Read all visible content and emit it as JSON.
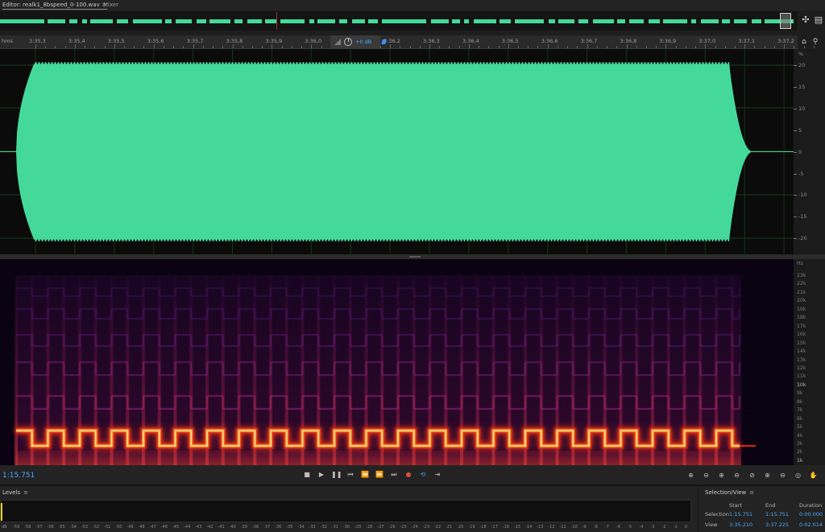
{
  "tabs": {
    "editor_label": "Editor: realk1_8bspeed_0-100.wav",
    "editor_menu": "≡",
    "mixer_label": "Mixer"
  },
  "ruler": {
    "unit": "hms",
    "ticks": [
      "3:35,3",
      "3:35,4",
      "3:35,5",
      "3:35,6",
      "3:35,7",
      "3:35,8",
      "3:35,9",
      "3:36,0",
      "3:36,1",
      "3:36,2",
      "3:36,3",
      "3:36,4",
      "3:36,5",
      "3:36,6",
      "3:36,7",
      "3:36,8",
      "3:36,9",
      "3:37,0",
      "3:37,1",
      "3:37,2"
    ]
  },
  "hud": {
    "gain_db": "+0 dB"
  },
  "amplitude_scale": {
    "unit": "%",
    "labels": [
      "20",
      "15",
      "10",
      "5",
      "0",
      "-5",
      "-10",
      "-15",
      "-20"
    ]
  },
  "frequency_scale": {
    "unit": "Hz",
    "labels": [
      "23k",
      "22k",
      "21k",
      "20k",
      "19k",
      "18k",
      "17k",
      "16k",
      "15k",
      "14k",
      "13k",
      "12k",
      "11k",
      "10k",
      "9k",
      "8k",
      "7k",
      "6k",
      "5k",
      "4k",
      "3k",
      "2k",
      "1k"
    ]
  },
  "transport": {
    "current_time": "1:15.751"
  },
  "levels": {
    "title": "Levels",
    "menu": "≡",
    "scale": [
      "dB",
      "-59",
      "-58",
      "-57",
      "-56",
      "-55",
      "-54",
      "-53",
      "-52",
      "-51",
      "-50",
      "-49",
      "-48",
      "-47",
      "-46",
      "-45",
      "-44",
      "-43",
      "-42",
      "-41",
      "-40",
      "-39",
      "-38",
      "-37",
      "-36",
      "-35",
      "-34",
      "-33",
      "-32",
      "-31",
      "-30",
      "-29",
      "-28",
      "-27",
      "-26",
      "-25",
      "-24",
      "-23",
      "-22",
      "-21",
      "-20",
      "-19",
      "-18",
      "-17",
      "-16",
      "-15",
      "-14",
      "-13",
      "-12",
      "-11",
      "-10",
      "-9",
      "-8",
      "-7",
      "-6",
      "-5",
      "-4",
      "-3",
      "-2",
      "-1",
      "0"
    ]
  },
  "selection_view": {
    "title": "Selection/View",
    "menu": "≡",
    "headers": {
      "start": "Start",
      "end": "End",
      "duration": "Duration"
    },
    "selection": {
      "label": "Selection",
      "start": "1:15.751",
      "end": "1:15.751",
      "duration": "0:00.000"
    },
    "view": {
      "label": "View",
      "start": "3:35.210",
      "end": "3:37.225",
      "duration": "0:02.014"
    }
  },
  "colors": {
    "waveform": "#44d99b",
    "accent_blue": "#4ca7ff",
    "playhead_red": "#9a3434",
    "meter_peak": "#e6d21a"
  }
}
